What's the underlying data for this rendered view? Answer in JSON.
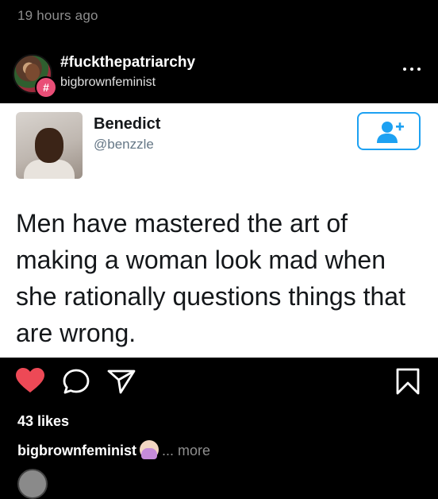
{
  "post": {
    "timestamp": "19 hours ago",
    "hashtag": "#fuckthepatriarchy",
    "hashtag_badge": "#",
    "account": "bigbrownfeminist",
    "likes": "43 likes",
    "caption_user": "bigbrownfeminist",
    "caption_more": "... more"
  },
  "tweet": {
    "name": "Benedict",
    "handle": "@benzzle",
    "text": "Men have mastered the art of making a woman look mad when she rationally questions things that are wrong."
  },
  "icons": {
    "header": "more-options-icon",
    "follow": "add-user-icon",
    "actions": [
      "heart-icon",
      "comment-icon",
      "share-icon",
      "bookmark-icon"
    ],
    "caption_emoji": "person-gesturing-no-emoji"
  },
  "colors": {
    "background": "#000000",
    "heart": "#ed4956",
    "hashtag_badge": "#e94e77",
    "twitter_blue": "#1da1f2",
    "muted_text": "#8e8e8e"
  }
}
